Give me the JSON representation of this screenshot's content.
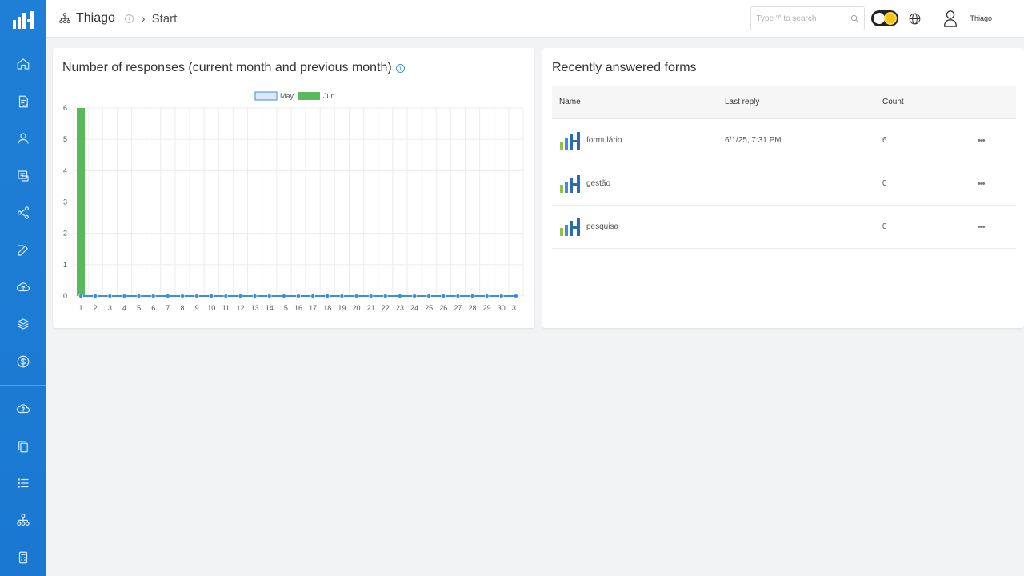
{
  "header": {
    "org_name": "Thiago",
    "breadcrumb": "Start",
    "search_placeholder": "Type '/' to search",
    "username": "Thiago"
  },
  "sidebar": {
    "items": [
      "home-icon",
      "forms-icon",
      "users-icon",
      "inbox-icon",
      "share-icon",
      "edit-icon",
      "upload-icon",
      "layers-icon",
      "billing-icon",
      "help-icon",
      "copy-icon",
      "list-icon",
      "hierarchy-icon",
      "calculator-icon"
    ]
  },
  "chart_card": {
    "title": "Number of responses (current month and previous month)"
  },
  "forms_card": {
    "title": "Recently answered forms",
    "columns": [
      "Name",
      "Last reply",
      "Count"
    ],
    "rows": [
      {
        "name": "formulário",
        "last_reply": "6/1/25, 7:31 PM",
        "count": "6",
        "more": "•••"
      },
      {
        "name": "gestão",
        "last_reply": "",
        "count": "0",
        "more": "•••"
      },
      {
        "name": "pesquisa",
        "last_reply": "",
        "count": "0",
        "more": "•••"
      }
    ]
  },
  "chart_data": {
    "type": "bar",
    "title": "",
    "xlabel": "",
    "ylabel": "",
    "categories": [
      "1",
      "2",
      "3",
      "4",
      "5",
      "6",
      "7",
      "8",
      "9",
      "10",
      "11",
      "12",
      "13",
      "14",
      "15",
      "16",
      "17",
      "18",
      "19",
      "20",
      "21",
      "22",
      "23",
      "24",
      "25",
      "26",
      "27",
      "28",
      "29",
      "30",
      "31"
    ],
    "series": [
      {
        "name": "May",
        "kind": "line",
        "color": "#3b8fe0",
        "values": [
          0,
          0,
          0,
          0,
          0,
          0,
          0,
          0,
          0,
          0,
          0,
          0,
          0,
          0,
          0,
          0,
          0,
          0,
          0,
          0,
          0,
          0,
          0,
          0,
          0,
          0,
          0,
          0,
          0,
          0,
          0
        ]
      },
      {
        "name": "Jun",
        "kind": "bar",
        "color": "#5cb85c",
        "values": [
          6,
          0,
          0,
          0,
          0,
          0,
          0,
          0,
          0,
          0,
          0,
          0,
          0,
          0,
          0,
          0,
          0,
          0,
          0,
          0,
          0,
          0,
          0,
          0,
          0,
          0,
          0,
          0,
          0,
          0,
          0
        ]
      }
    ],
    "ylim": [
      0,
      6
    ],
    "yticks": [
      "0",
      "1",
      "2",
      "3",
      "4",
      "5",
      "6"
    ],
    "legend": "top-center",
    "grid": true
  }
}
